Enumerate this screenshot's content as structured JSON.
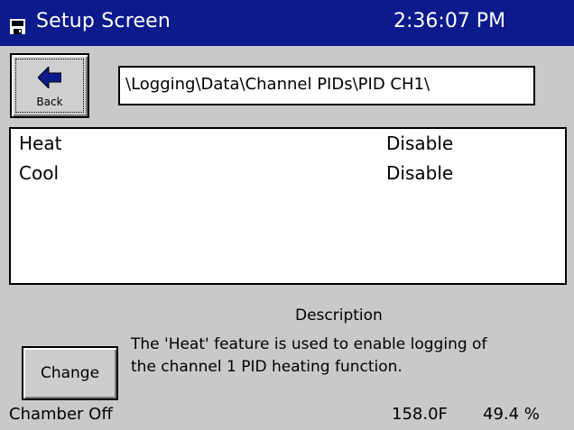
{
  "colors": {
    "titlebar_bg": "#0c1a8c",
    "titlebar_text": "#ffffff",
    "background": "#c9c9c9",
    "list_bg": "#ffffff"
  },
  "titlebar": {
    "icon": "floppy-disk-icon",
    "title": "Setup Screen",
    "clock": "2:36:07 PM"
  },
  "toolbar": {
    "back_icon": "left-arrow-icon",
    "back_label": "Back",
    "path": "\\Logging\\Data\\Channel PIDs\\PID CH1\\"
  },
  "list": {
    "items": [
      {
        "name": "Heat",
        "value": "Disable"
      },
      {
        "name": "Cool",
        "value": "Disable"
      }
    ]
  },
  "description": {
    "heading": "Description",
    "line1": "The 'Heat' feature is used to enable logging of",
    "line2": "the channel 1 PID heating function."
  },
  "actions": {
    "change_label": "Change"
  },
  "status": {
    "chamber": "Chamber Off",
    "temperature": "158.0F",
    "humidity": "49.4 %"
  }
}
